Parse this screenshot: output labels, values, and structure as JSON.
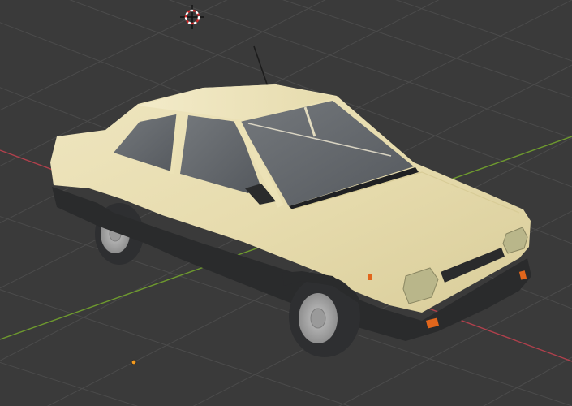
{
  "viewport": {
    "background": "#3a3a3a",
    "grid_color": "#4b4b4b",
    "x_axis_color": "#b0404c",
    "y_axis_color": "#6e9a2e",
    "object_name": "car-sedan"
  },
  "car": {
    "body_color": "#e9dfb3",
    "trim_color": "#2a2b2c",
    "glass_color": "#5d6166",
    "tire_color": "#2e2f31",
    "hub_color": "#a6a6a6",
    "indicator_color": "#e1661c",
    "headlight_color": "#b9b68a"
  },
  "icons": {
    "cursor": "3d-cursor-icon",
    "origin": "object-origin-icon"
  }
}
